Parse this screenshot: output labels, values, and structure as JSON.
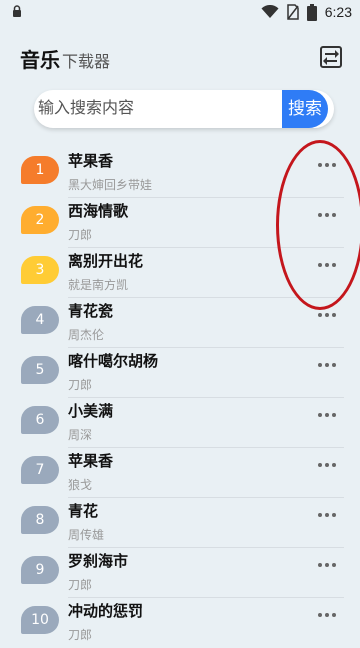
{
  "status_bar": {
    "time": "6:23"
  },
  "header": {
    "brand": "音乐",
    "subtitle": "下载器"
  },
  "search": {
    "placeholder": "输入搜索内容",
    "button_label": "搜索"
  },
  "colors": {
    "background": "#e9f0f4",
    "accent": "#2f7cf6",
    "rank1": "#f57c2b",
    "rank2": "#ffad2f",
    "rank3": "#ffcc35",
    "rank_other": "#9aa9bc",
    "annotation": "#c4161c"
  },
  "songs": [
    {
      "rank": "1",
      "title": "苹果香",
      "artist": "黑大婶回乡带娃"
    },
    {
      "rank": "2",
      "title": "西海情歌",
      "artist": "刀郎"
    },
    {
      "rank": "3",
      "title": "离别开出花",
      "artist": "就是南方凯"
    },
    {
      "rank": "4",
      "title": "青花瓷",
      "artist": "周杰伦"
    },
    {
      "rank": "5",
      "title": "喀什噶尔胡杨",
      "artist": "刀郎"
    },
    {
      "rank": "6",
      "title": "小美满",
      "artist": "周深"
    },
    {
      "rank": "7",
      "title": "苹果香",
      "artist": "狼戈"
    },
    {
      "rank": "8",
      "title": "青花",
      "artist": "周传雄"
    },
    {
      "rank": "9",
      "title": "罗刹海市",
      "artist": "刀郎"
    },
    {
      "rank": "10",
      "title": "冲动的惩罚",
      "artist": "刀郎"
    }
  ]
}
